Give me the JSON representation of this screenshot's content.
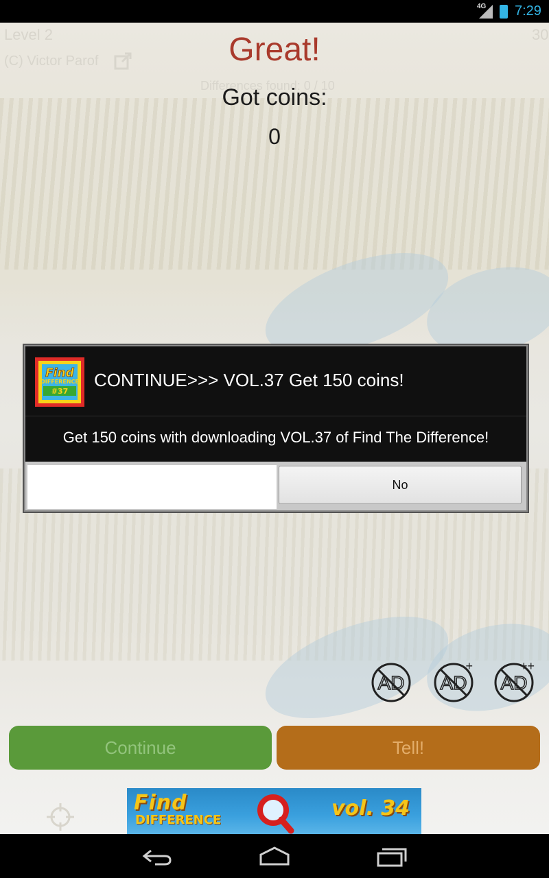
{
  "status_bar": {
    "network": "4G",
    "time": "7:29",
    "accent_color": "#33b5e5"
  },
  "game": {
    "level": "Level 2",
    "author": "(C) Victor Parof",
    "top_number": "30",
    "differences_found": "Differences found: 0 / 10",
    "result_title": "Great!",
    "coins_label": "Got coins:",
    "coins_value": "0",
    "ad_icons": [
      {
        "label": "AD",
        "suffix": "",
        "icon": "no-ads-icon"
      },
      {
        "label": "AD",
        "suffix": "+",
        "icon": "no-ads-plus-icon"
      },
      {
        "label": "AD",
        "suffix": "++",
        "icon": "no-ads-plus-plus-icon"
      }
    ],
    "continue_label": "Continue",
    "tell_label": "Tell!",
    "continue_color": "#5a9a3a",
    "tell_color": "#b46d1a"
  },
  "ad_banner": {
    "logo_line1": "Find",
    "logo_line2": "DIFFERENCE",
    "volume": "vol. 34"
  },
  "dialog": {
    "title": "CONTINUE>>> VOL.37 Get 150 coins!",
    "app_icon": {
      "line1": "Find",
      "line2": "DIFFERENCE",
      "number": "#37"
    },
    "message": "Get 150 coins with downloading VOL.37 of Find The Difference!",
    "positive_label": "",
    "negative_label": "No"
  },
  "nav_bar": {
    "back": "back-icon",
    "home": "home-icon",
    "recents": "recents-icon"
  }
}
